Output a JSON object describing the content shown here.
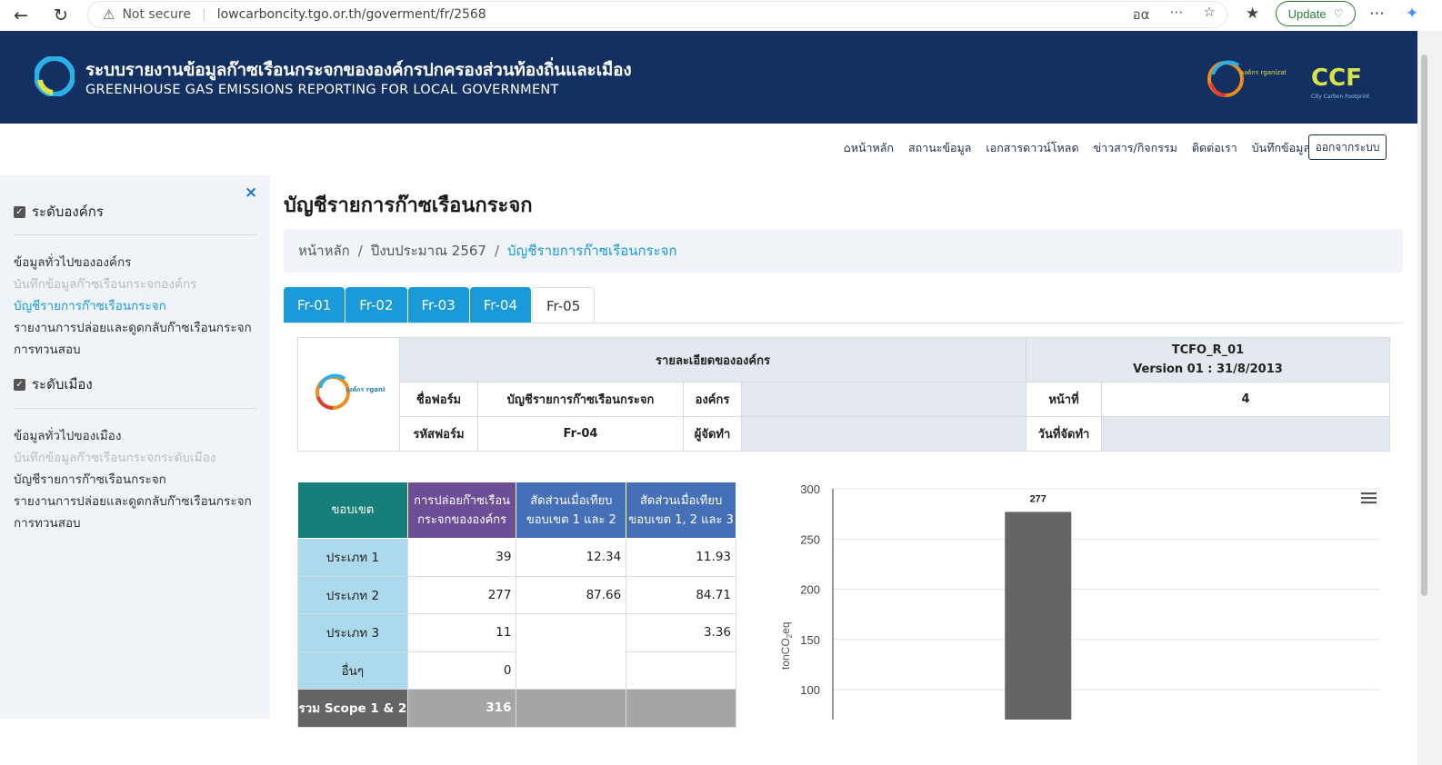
{
  "browser": {
    "security": "Not secure",
    "url": "lowcarboncity.tgo.or.th/goverment/fr/2568",
    "update_label": "Update"
  },
  "banner": {
    "title_th": "ระบบรายงานข้อมูลก๊าซเรือนกระจกขององค์กรปกครองส่วนท้องถิ่นและเมือง",
    "title_en": "GREENHOUSE GAS EMISSIONS REPORTING FOR LOCAL GOVERNMENT",
    "logo_org_text": "องค์กร rganization",
    "logo_ccf_text": "CCF",
    "logo_ccf_sub": "City Carbon Footprint"
  },
  "topnav": {
    "items": [
      "หน้าหลัก",
      "สถานะข้อมูล",
      "เอกสารดาวน์โหลด",
      "ข่าวสาร/กิจกรรม",
      "ติดต่อเรา",
      "บันทึกข้อมูล"
    ],
    "logout": "ออกจากระบบ"
  },
  "sidebar": {
    "close": "×",
    "org_section": "ระดับองค์กร",
    "org_items": [
      "ข้อมูลทั่วไปขององค์กร",
      "บันทึกข้อมูลก๊าซเรือนกระจกองค์กร",
      "บัญชีรายการก๊าซเรือนกระจก",
      "รายงานการปล่อยและดูดกลับก๊าซเรือนกระจก",
      "การทวนสอบ"
    ],
    "city_section": "ระดับเมือง",
    "city_items": [
      "ข้อมูลทั่วไปของเมือง",
      "บันทึกข้อมูลก๊าซเรือนกระจกระดับเมือง",
      "บัญชีรายการก๊าซเรือนกระจก",
      "รายงานการปล่อยและดูดกลับก๊าซเรือนกระจก",
      "การทวนสอบ"
    ]
  },
  "main": {
    "title": "บัญชีรายการก๊าซเรือนกระจก",
    "breadcrumb": [
      "หน้าหลัก",
      "ปีงบประมาณ 2567",
      "บัญชีรายการก๊าซเรือนกระจก"
    ],
    "tabs": [
      "Fr-01",
      "Fr-02",
      "Fr-03",
      "Fr-04",
      "Fr-05"
    ],
    "active_tab": "Fr-05"
  },
  "info_table": {
    "header": "รายละเอียดขององค์กร",
    "code": "TCFO_R_01",
    "version": "Version 01 : 31/8/2013",
    "form_name_label": "ชื่อฟอร์ม",
    "form_name": "บัญชีรายการก๊าซเรือนกระจก",
    "org_label": "องค์กร",
    "org_value": "",
    "page_label": "หน้าที่",
    "page_value": "4",
    "form_code_label": "รหัสฟอร์ม",
    "form_code": "Fr-04",
    "preparer_label": "ผู้จัดทำ",
    "preparer_value": "",
    "date_label": "วันที่จัดทำ",
    "date_value": ""
  },
  "data_table": {
    "headers": [
      "ขอบเขต",
      "การปล่อยก๊าซเรือน กระจกขององค์กร",
      "สัดส่วนเมื่อเทียบ ขอบเขต 1 และ 2",
      "สัดส่วนเมื่อเทียบ ขอบเขต 1, 2 และ 3"
    ],
    "rows": [
      {
        "label": "ประเภท 1",
        "emission": "39",
        "ratio12": "12.34",
        "ratio123": "11.93"
      },
      {
        "label": "ประเภท 2",
        "emission": "277",
        "ratio12": "87.66",
        "ratio123": "84.71"
      },
      {
        "label": "ประเภท 3",
        "emission": "11",
        "ratio12": "",
        "ratio123": "3.36"
      },
      {
        "label": "อื่นๆ",
        "emission": "0",
        "ratio12": "",
        "ratio123": ""
      }
    ],
    "total": {
      "label": "รวม Scope 1 & 2",
      "emission": "316"
    }
  },
  "chart_data": {
    "type": "bar",
    "categories": [
      ""
    ],
    "values": [
      277
    ],
    "data_labels": [
      "277"
    ],
    "ylabel": "tonCO2eq",
    "yticks": [
      300,
      250,
      200,
      150,
      100
    ],
    "ylim_visible": [
      100,
      300
    ],
    "bar_color": "#656565",
    "grid": true
  }
}
